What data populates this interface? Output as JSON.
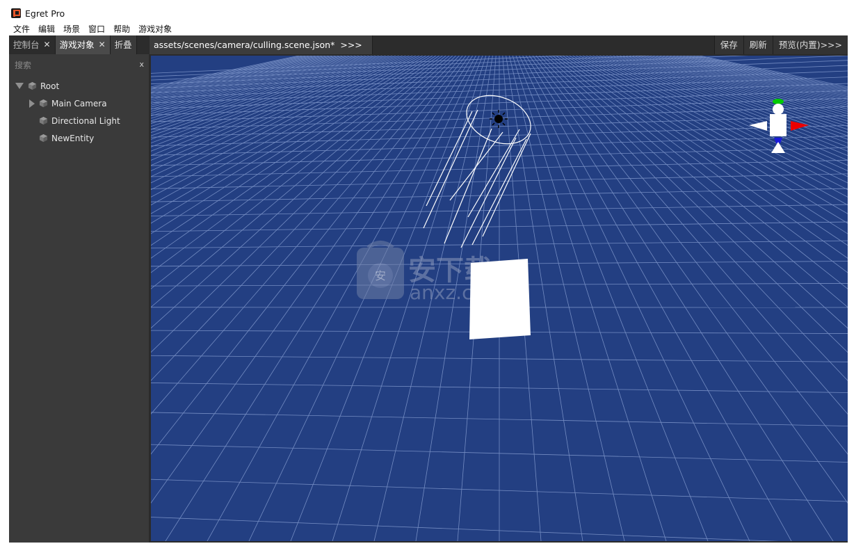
{
  "window": {
    "title": "Egret Pro"
  },
  "menu": [
    "文件",
    "编辑",
    "场景",
    "窗口",
    "帮助",
    "游戏对象"
  ],
  "left_tabs": [
    {
      "label": "控制台",
      "close": "✕"
    },
    {
      "label": "游戏对象",
      "close": "✕"
    },
    {
      "label": "折叠"
    }
  ],
  "search": {
    "placeholder": "搜索",
    "clear": "x"
  },
  "hierarchy": [
    {
      "label": "Root",
      "expanded": true,
      "icon": "cube-icon"
    },
    {
      "label": "Main Camera",
      "expanded": false,
      "icon": "cube-icon"
    },
    {
      "label": "Directional Light",
      "icon": "cube-icon"
    },
    {
      "label": "NewEntity",
      "icon": "cube-icon"
    }
  ],
  "scene_tab": {
    "path": "assets/scenes/camera/culling.scene.json*",
    "more": ">>>"
  },
  "scene_actions": [
    "保存",
    "刷新",
    "预览(内置)>>>"
  ],
  "watermark": {
    "line1": "安下载",
    "line2": "anxz.com"
  },
  "colors": {
    "viewport_bg": "#233f82",
    "gizmo_x": "#ff0000",
    "gizmo_y": "#00cc00",
    "gizmo_z": "#0000ff"
  }
}
